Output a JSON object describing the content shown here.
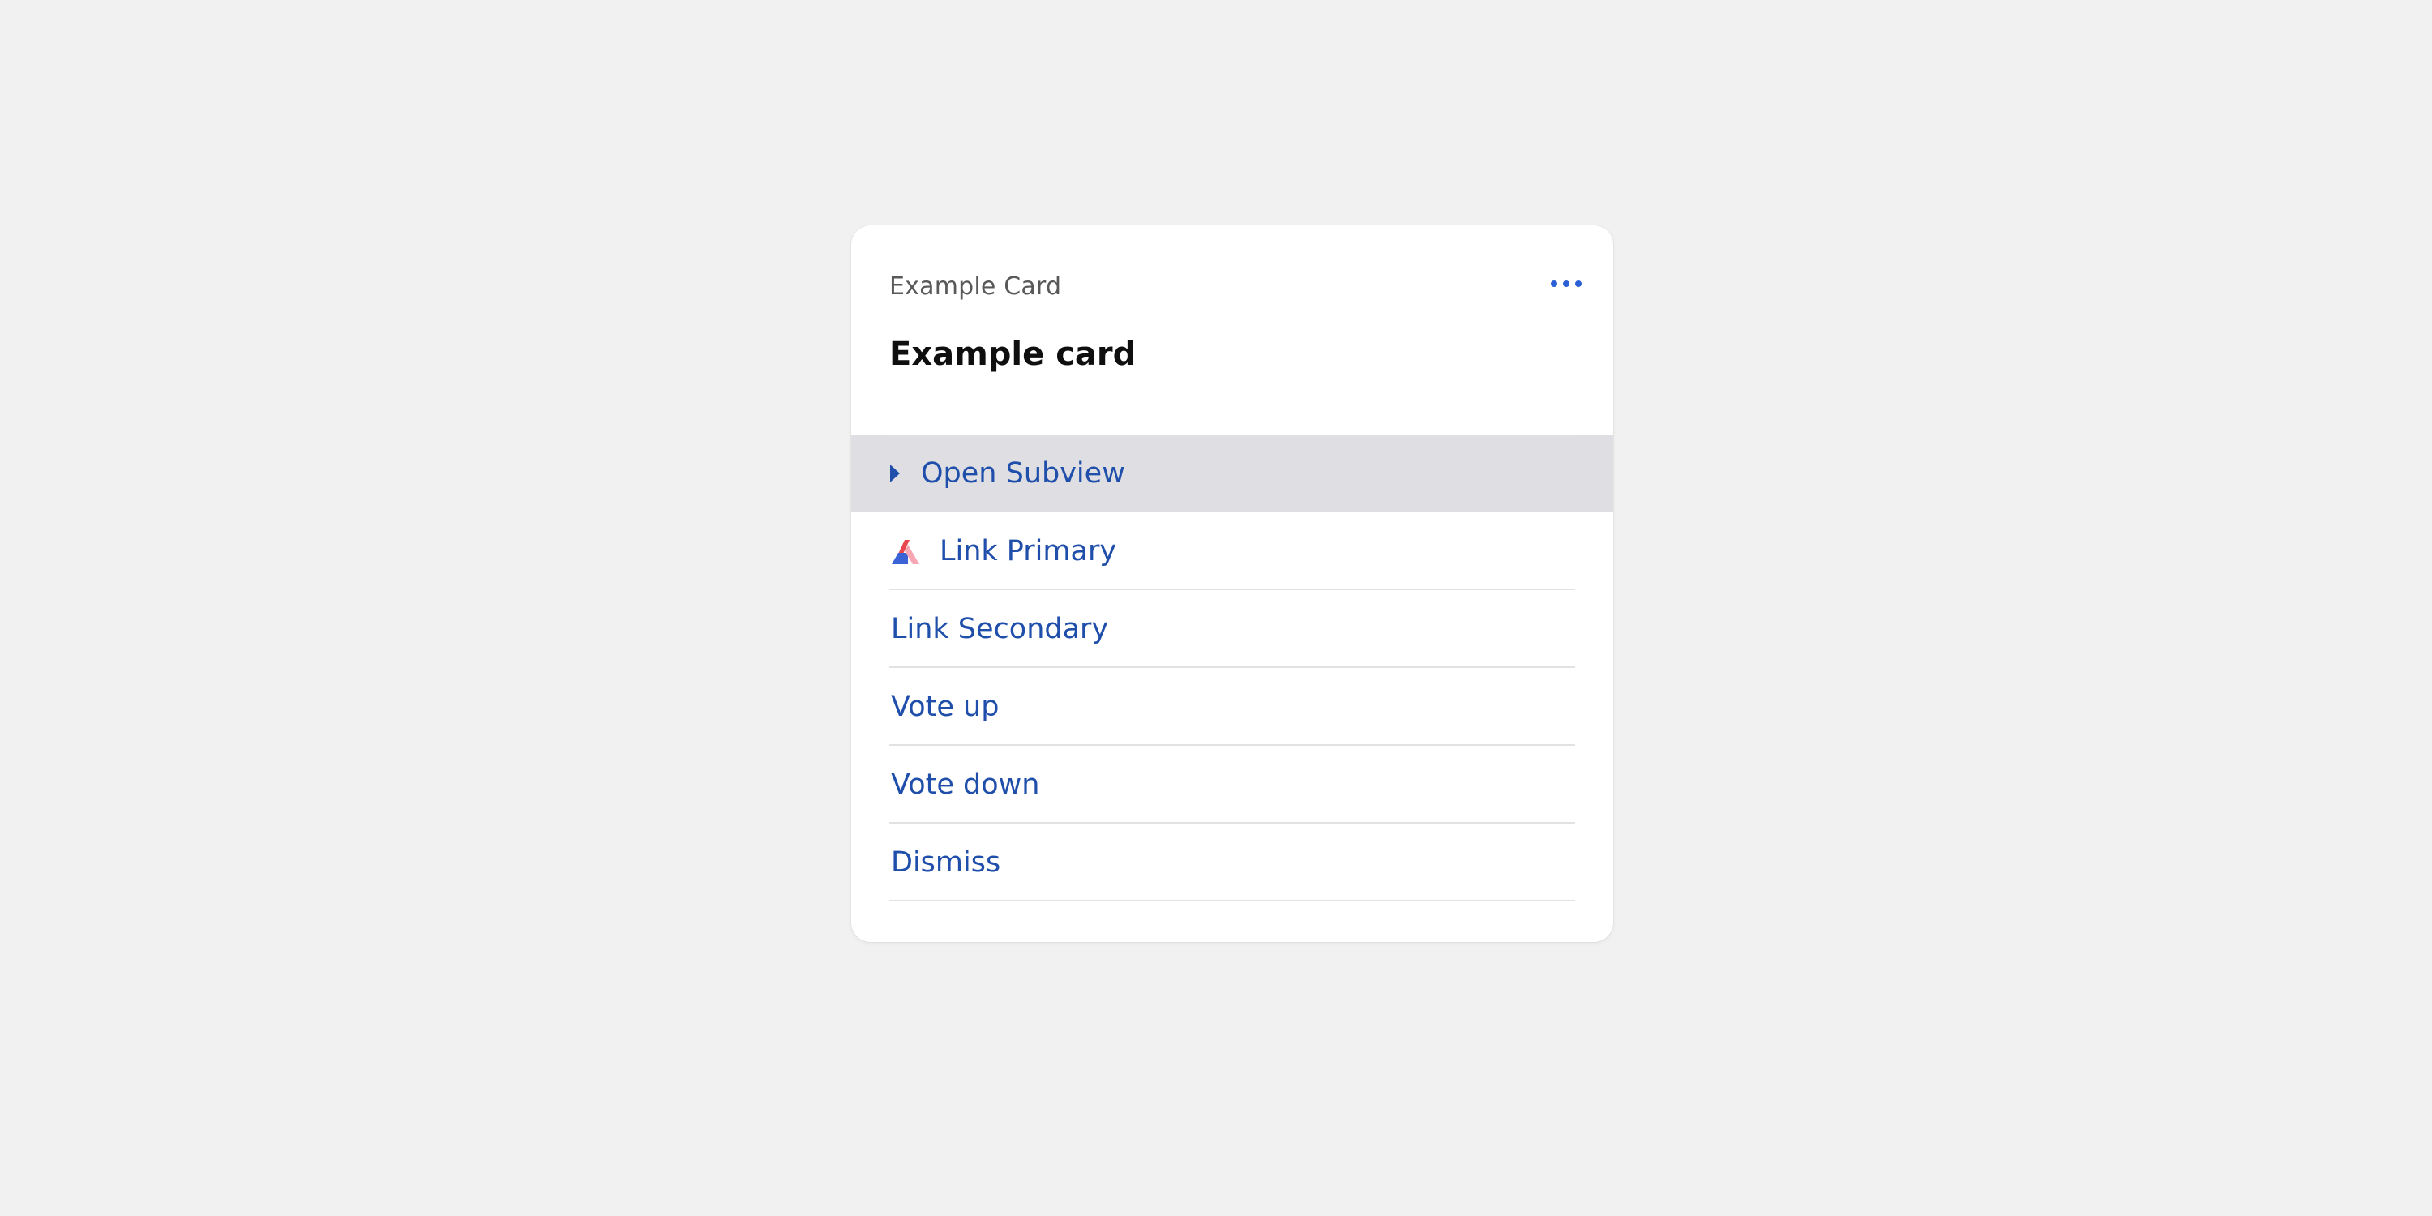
{
  "card": {
    "label": "Example Card",
    "title": "Example card",
    "menu_icon": "more-horizontal-icon"
  },
  "items": [
    {
      "label": "Open Subview",
      "icon": "caret-right-icon",
      "highlighted": true
    },
    {
      "label": "Link Primary",
      "icon": "brand-logo-icon"
    },
    {
      "label": "Link Secondary"
    },
    {
      "label": "Vote up"
    },
    {
      "label": "Vote down"
    },
    {
      "label": "Dismiss"
    }
  ],
  "colors": {
    "background": "#f1f1f1",
    "card": "#ffffff",
    "link": "#1f4faa",
    "highlight": "#dfdfe3",
    "divider": "#e2e2e2",
    "label": "#595959",
    "accent_dots": "#2b5fd6",
    "brand_red": "#e8474f",
    "brand_blue": "#3b63d6",
    "brand_pink": "#f7a7b3"
  }
}
